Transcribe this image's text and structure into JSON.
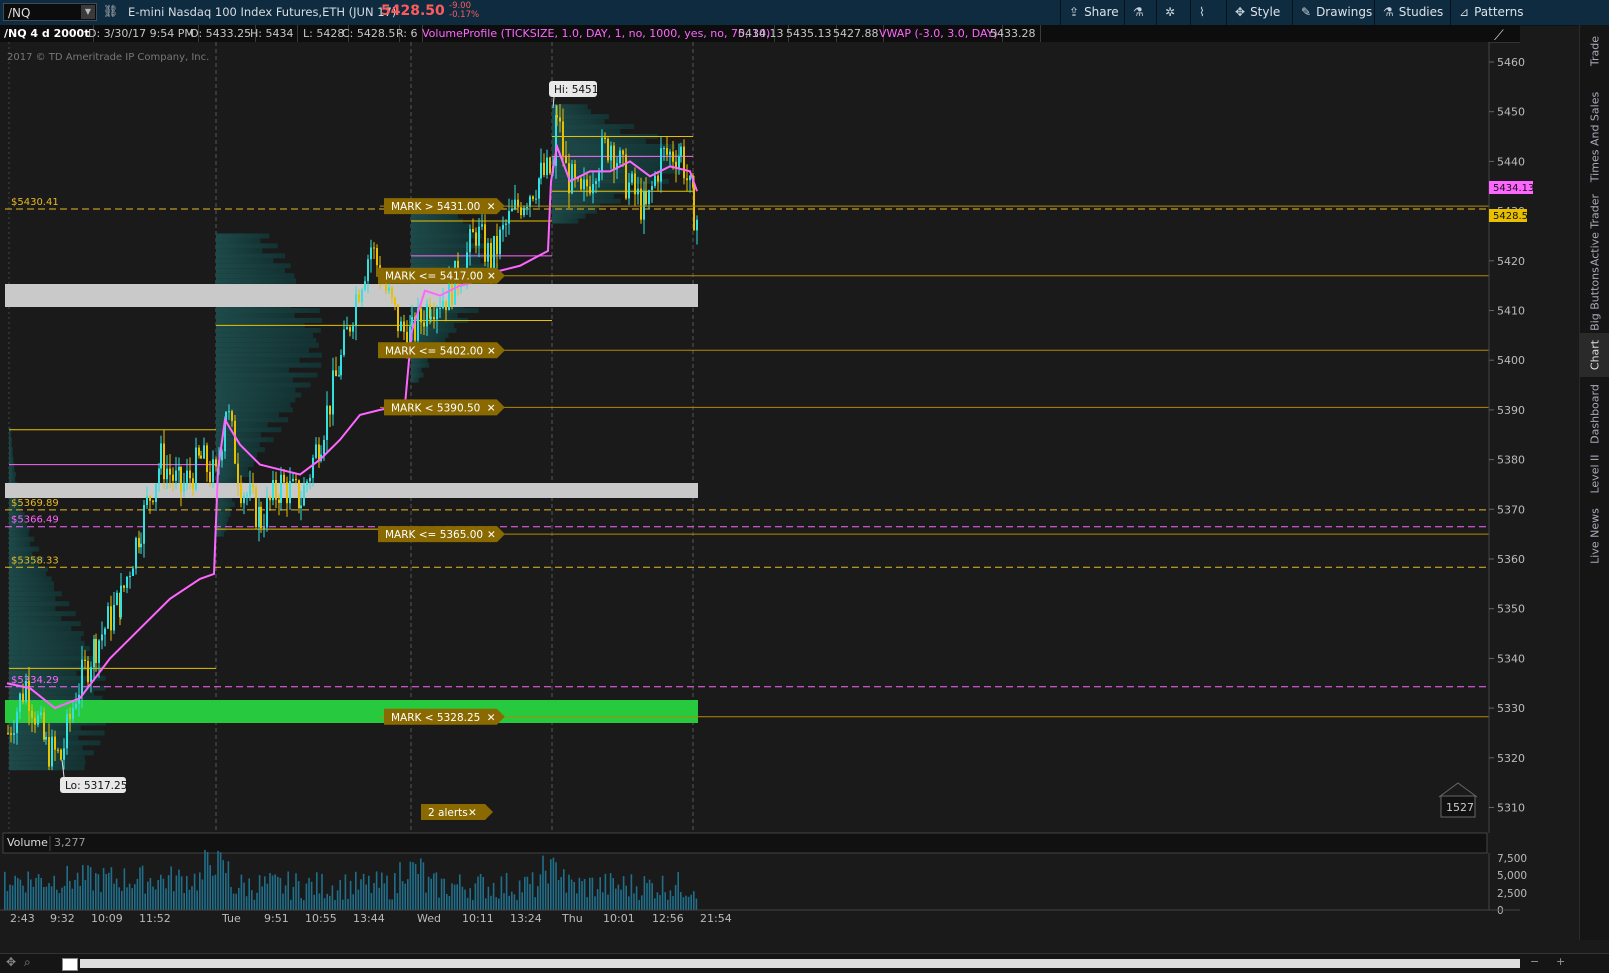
{
  "toolbar": {
    "symbol": "/NQ",
    "description": "E-mini Nasdaq 100 Index Futures,ETH (JUN 17)",
    "last": "5428.50",
    "net_change": "-9.00",
    "pct_change": "-0.17%",
    "share": "Share",
    "style": "Style",
    "drawings": "Drawings",
    "studies": "Studies",
    "patterns": "Patterns"
  },
  "header": {
    "chart_id": "/NQ 4 d 2000t",
    "date": "D: 3/30/17 9:54 PM",
    "open": "O: 5433.25",
    "high": "H: 5434",
    "low": "L: 5428",
    "close": "C: 5428.5",
    "range": "R: 6",
    "study1": "VolumeProfile (TICKSIZE, 1.0, DAY, 1, no, 1000, yes, no, 70, 10)",
    "vp_poc": "5434.13",
    "vp_high": "5435.13",
    "vp_low": "5427.88",
    "study2": "VWAP (-3.0, 3.0, DAY)",
    "vwap_val": "5433.28"
  },
  "chart": {
    "copyright": "2017 © TD Ameritrade IP Company, Inc.",
    "hi_label": "Hi: 5451",
    "lo_label": "Lo: 5317.25",
    "alerts_badge": "2 alerts",
    "tick_counter": "1527",
    "price_badge_vwap": "5434.13",
    "price_badge_last": "5428.5",
    "colors": {
      "accent": "#e8b923",
      "vwap": "#ff66ff",
      "up": "#33e0e0",
      "down": "#e8c000",
      "mark": "#8a6a00",
      "green_zone": "#27c93f",
      "gray_zone": "#c9c9c9"
    },
    "y_ticks": [
      "5460",
      "5450",
      "5440",
      "5430",
      "5420",
      "5410",
      "5400",
      "5390",
      "5380",
      "5370",
      "5360",
      "5350",
      "5340",
      "5330",
      "5320",
      "5310"
    ],
    "levels": [
      {
        "label": "$5430.41",
        "value": 5430.41,
        "color": "#e8b923"
      },
      {
        "label": "$5369.89",
        "value": 5369.89,
        "color": "#e8b923"
      },
      {
        "label": "$5366.49",
        "value": 5366.49,
        "color": "#ff66ff"
      },
      {
        "label": "$5358.33",
        "value": 5358.33,
        "color": "#e8b923"
      },
      {
        "label": "$5334.29",
        "value": 5334.29,
        "color": "#ff66ff"
      }
    ],
    "marks": [
      {
        "label": "MARK > 5431.00",
        "value": 5431.0
      },
      {
        "label": "MARK <= 5417.00",
        "value": 5417.0
      },
      {
        "label": "MARK <= 5402.00",
        "value": 5402.0
      },
      {
        "label": "MARK < 5390.50",
        "value": 5390.5
      },
      {
        "label": "MARK <= 5365.00",
        "value": 5365.0
      },
      {
        "label": "MARK < 5328.25",
        "value": 5328.25
      }
    ]
  },
  "volume": {
    "label": "Volume",
    "value": "3,277",
    "y_ticks": [
      "7,500",
      "5,000",
      "2,500",
      "0"
    ]
  },
  "x_ticks": [
    "2:43",
    "9:32",
    "10:09",
    "11:52",
    "Tue",
    "9:51",
    "10:55",
    "13:44",
    "Wed",
    "10:11",
    "13:24",
    "Thu",
    "10:01",
    "12:56",
    "21:54"
  ],
  "side_tabs": [
    "Trade",
    "Times And Sales",
    "Active Trader",
    "Big Buttons",
    "Chart",
    "Dashboard",
    "Level II",
    "Live News"
  ]
}
